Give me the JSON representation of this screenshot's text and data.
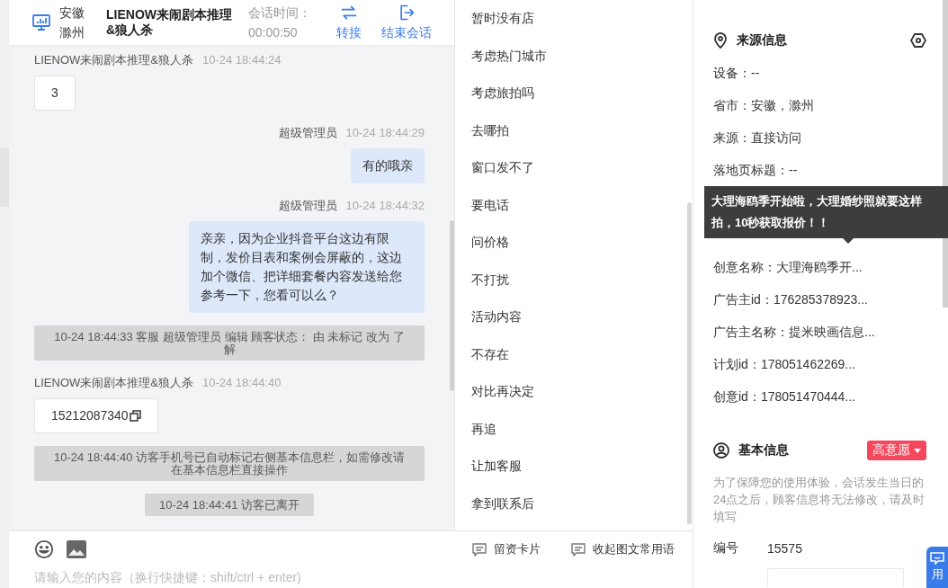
{
  "header": {
    "location": [
      "安徽",
      "滁州"
    ],
    "title": "LIENOW来闹剧本推理&狼人杀",
    "duration_label": "会话时间：",
    "duration": "00:00:50",
    "actions": [
      "转接",
      "结束会话"
    ]
  },
  "messages": [
    {
      "kind": "visitor",
      "sender": "LIENOW来闹剧本推理&狼人杀",
      "time": "10-24 18:44:24",
      "text": "3",
      "copyable": false
    },
    {
      "kind": "agent",
      "sender": "超级管理员",
      "time": "10-24 18:44:29",
      "text": "有的哦亲"
    },
    {
      "kind": "agent",
      "sender": "超级管理员",
      "time": "10-24 18:44:32",
      "text": "亲亲，因为企业抖音平台这边有限制，发价目表和案例会屏蔽的，这边加个微信、把详细套餐内容发送给您参考一下，您看可以么？"
    },
    {
      "kind": "system",
      "text": "10-24 18:44:33 客服 超级管理员 编辑 顾客状态： 由 未标记 改为 了解"
    },
    {
      "kind": "visitor",
      "sender": "LIENOW来闹剧本推理&狼人杀",
      "time": "10-24 18:44:40",
      "text": "15212087340",
      "copyable": true
    },
    {
      "kind": "system",
      "text": "10-24 18:44:40 访客手机号已自动标记右侧基本信息栏，如需修改请在基本信息栏直接操作"
    },
    {
      "kind": "system",
      "text": "10-24 18:44:41 访客已离开"
    }
  ],
  "quick_replies": [
    "暂时没有店",
    "考虑热门城市",
    "考虑旅拍吗",
    "去哪拍",
    "窗口发不了",
    "要电话",
    "问价格",
    "不打扰",
    "活动内容",
    "不存在",
    "对比再决定",
    "再追",
    "让加客服",
    "拿到联系后"
  ],
  "composer": {
    "placeholder": "请输入您的内容（换行快捷键：shift/ctrl + enter)",
    "actions": [
      "留资卡片",
      "收起图文常用语"
    ]
  },
  "source_info": {
    "title": "来源信息",
    "rows_above": [
      "设备：--",
      "省市：安徽，滁州",
      "来源：直接访问",
      "落地页标题：--"
    ],
    "tooltip": "大理海鸥季开始啦，大理婚纱照就要这样拍，10秒获取报价！！",
    "rows_below": [
      "创意名称：大理海鸥季开...",
      "广告主id：176285378923...",
      "广告主名称：提米映画信息...",
      "计划id：178051462269...",
      "创意id：178051470444..."
    ]
  },
  "basic_info": {
    "title": "基本信息",
    "tag": {
      "label": "高意愿",
      "color": "#f5475b"
    },
    "note": "为了保障您的使用体验，会话发生当日的24点之后，顾客信息将无法修改，请及时填写",
    "fields": [
      {
        "label": "编号",
        "value": "15575"
      }
    ]
  },
  "floating_button": {
    "label": "用"
  }
}
